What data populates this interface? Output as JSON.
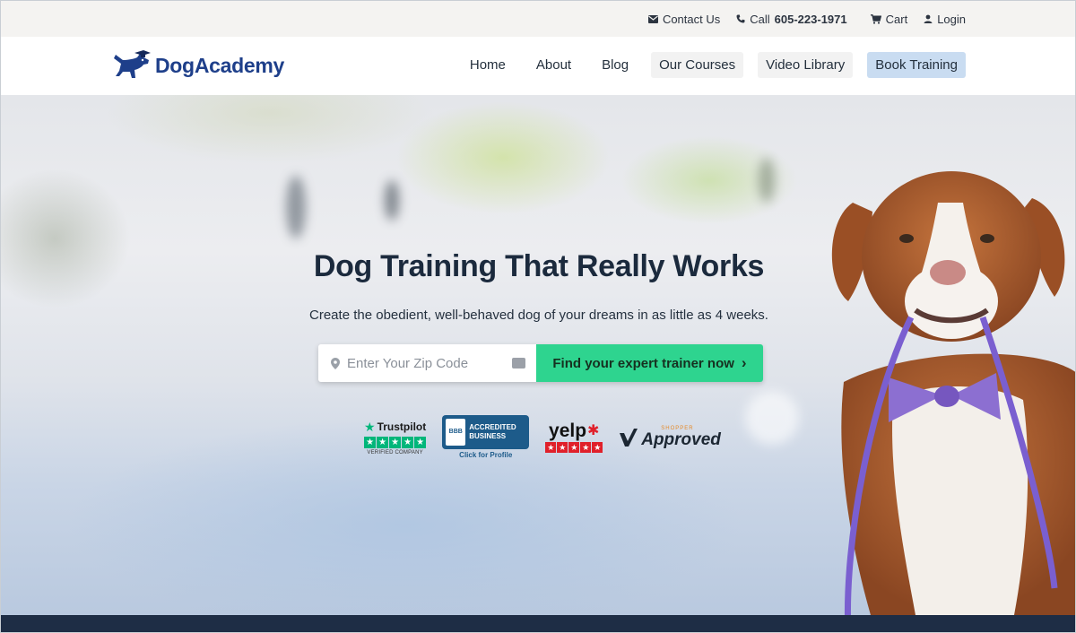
{
  "topbar": {
    "contact_label": "Contact Us",
    "call_prefix": "Call",
    "phone": "605-223-1971",
    "cart_label": "Cart",
    "login_label": "Login"
  },
  "brand": {
    "name_part1": "Dog",
    "name_part2": "Academy"
  },
  "nav": {
    "items": [
      {
        "label": "Home"
      },
      {
        "label": "About"
      },
      {
        "label": "Blog"
      },
      {
        "label": "Our Courses"
      },
      {
        "label": "Video Library"
      },
      {
        "label": "Book Training"
      }
    ]
  },
  "hero": {
    "headline": "Dog Training That Really Works",
    "subline": "Create the obedient, well-behaved dog of your dreams in as little as 4 weeks.",
    "zip_placeholder": "Enter Your Zip Code",
    "find_button": "Find your expert trainer now",
    "find_chevron": "›"
  },
  "badges": {
    "trustpilot": {
      "name": "Trustpilot",
      "sub": "VERIFIED COMPANY",
      "stars": 5
    },
    "bbb": {
      "seal": "BBB",
      "line1": "ACCREDITED",
      "line2": "BUSINESS",
      "sub": "Click for Profile"
    },
    "yelp": {
      "name": "yelp",
      "stars": 5
    },
    "shopper_approved": {
      "top": "SHOPPER",
      "main": "Approved"
    }
  },
  "colors": {
    "accent_green": "#2ed48f",
    "nav_cta_bg": "#c9dcf1",
    "brand_blue": "#1e3f8a",
    "footer_strip": "#1e2d45"
  }
}
